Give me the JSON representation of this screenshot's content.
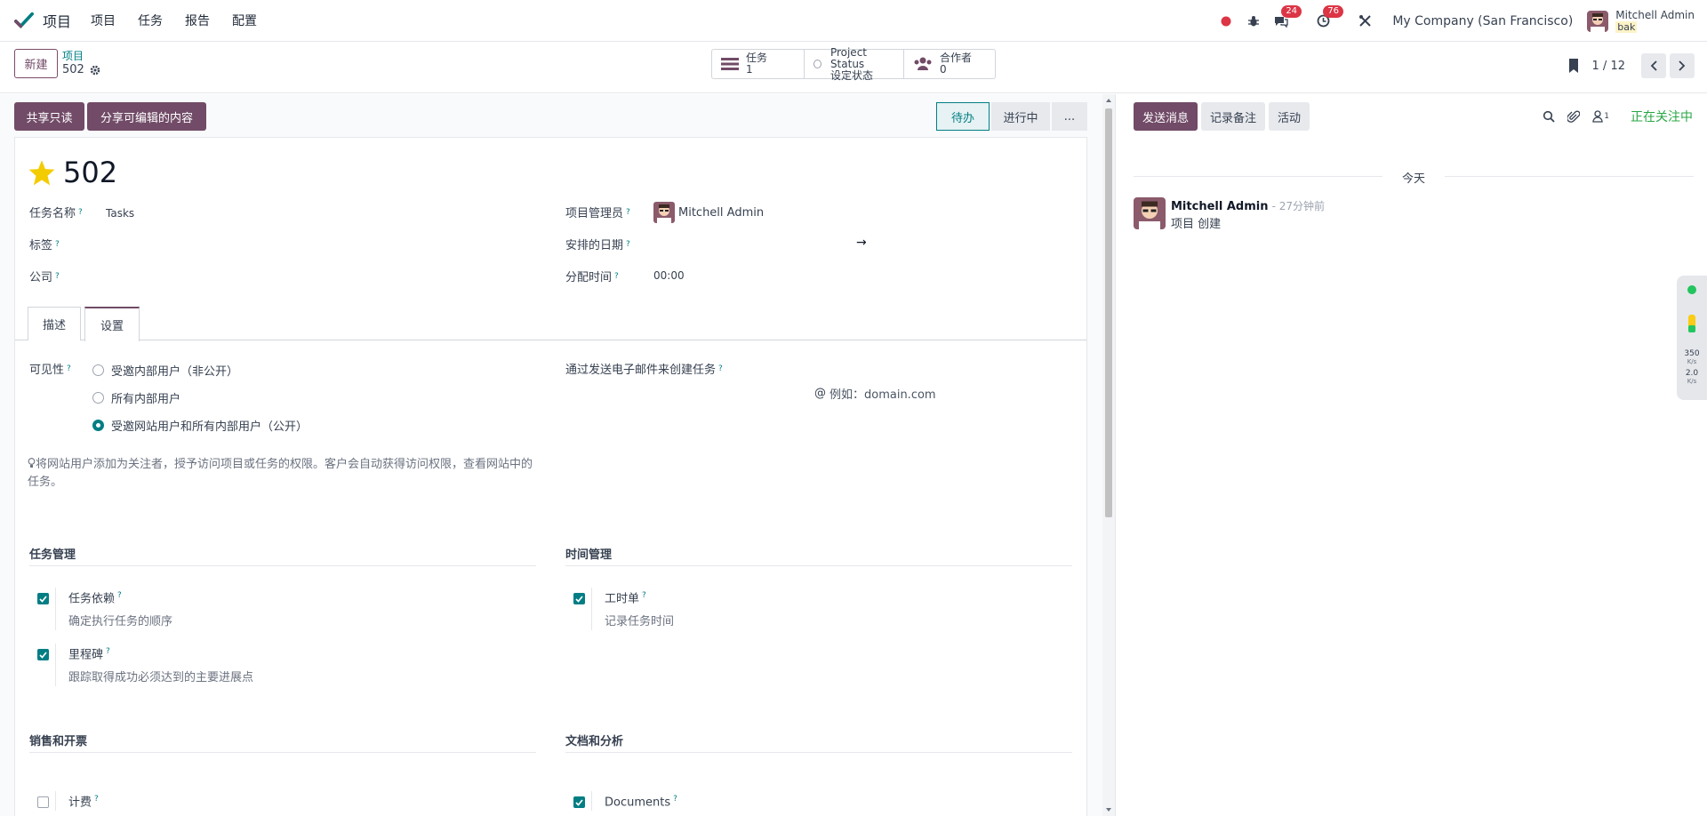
{
  "nav": {
    "app_name": "项目",
    "menu": [
      "项目",
      "任务",
      "报告",
      "配置"
    ],
    "messages_count": "24",
    "activities_count": "76",
    "company": "My Company (San Francisco)",
    "user_name": "Mitchell Admin",
    "db_name": "bak"
  },
  "control": {
    "new_label": "新建",
    "breadcrumb_parent": "项目",
    "breadcrumb_current": "502",
    "smart_buttons": [
      {
        "label": "任务",
        "value": "1"
      },
      {
        "label": "Project Status",
        "value": "设定状态"
      },
      {
        "label": "合作者",
        "value": "0"
      }
    ],
    "pager": "1 / 12"
  },
  "form": {
    "share_readonly": "共享只读",
    "share_editable": "分享可编辑的内容",
    "stages": [
      "待办",
      "进行中",
      "..."
    ],
    "title": "502",
    "task_name_label": "任务名称",
    "task_name_value": "Tasks",
    "tags_label": "标签",
    "company_label": "公司",
    "manager_label": "项目管理员",
    "manager_value": "Mitchell Admin",
    "dates_label": "安排的日期",
    "date_arrow": "→",
    "alloc_label": "分配时间",
    "alloc_value": "00:00",
    "tabs": [
      "描述",
      "设置"
    ],
    "visibility_label": "可见性",
    "visibility_options": [
      "受邀内部用户（非公开）",
      "所有内部用户",
      "受邀网站用户和所有内部用户（公开）"
    ],
    "visibility_selected": 2,
    "email_label": "通过发送电子邮件来创建任务",
    "email_placeholder": "例如：domain.com",
    "email_at": "@",
    "hint": "将网站用户添加为关注者，授予访问项目或任务的权限。客户会自动获得访问权限，查看网站中的任务。",
    "sections": {
      "task_mgmt": "任务管理",
      "time_mgmt": "时间管理",
      "sales": "销售和开票",
      "docs": "文档和分析"
    },
    "options": {
      "dependencies": {
        "title": "任务依赖",
        "desc": "确定执行任务的顺序",
        "checked": true
      },
      "milestones": {
        "title": "里程碑",
        "desc": "跟踪取得成功必须达到的主要进展点",
        "checked": true
      },
      "timesheets": {
        "title": "工时单",
        "desc": "记录任务时间",
        "checked": true
      },
      "billable": {
        "title": "计费",
        "checked": false
      },
      "documents": {
        "title": "Documents",
        "checked": true
      }
    }
  },
  "chatter": {
    "send_message": "发送消息",
    "log_note": "记录备注",
    "activities": "活动",
    "followers_count": "1",
    "following": "正在关注中",
    "today": "今天",
    "message": {
      "author": "Mitchell Admin",
      "time": "- 27分钟前",
      "body": "项目 创建"
    }
  },
  "widget": {
    "up_speed": "350",
    "up_unit": "K/s",
    "down_speed": "2.0",
    "down_unit": "K/s"
  },
  "colors": {
    "brand": "#714b67",
    "accent": "#017e84",
    "following": "#28a745",
    "badge": "#dc3545",
    "star": "#f3cc00"
  }
}
